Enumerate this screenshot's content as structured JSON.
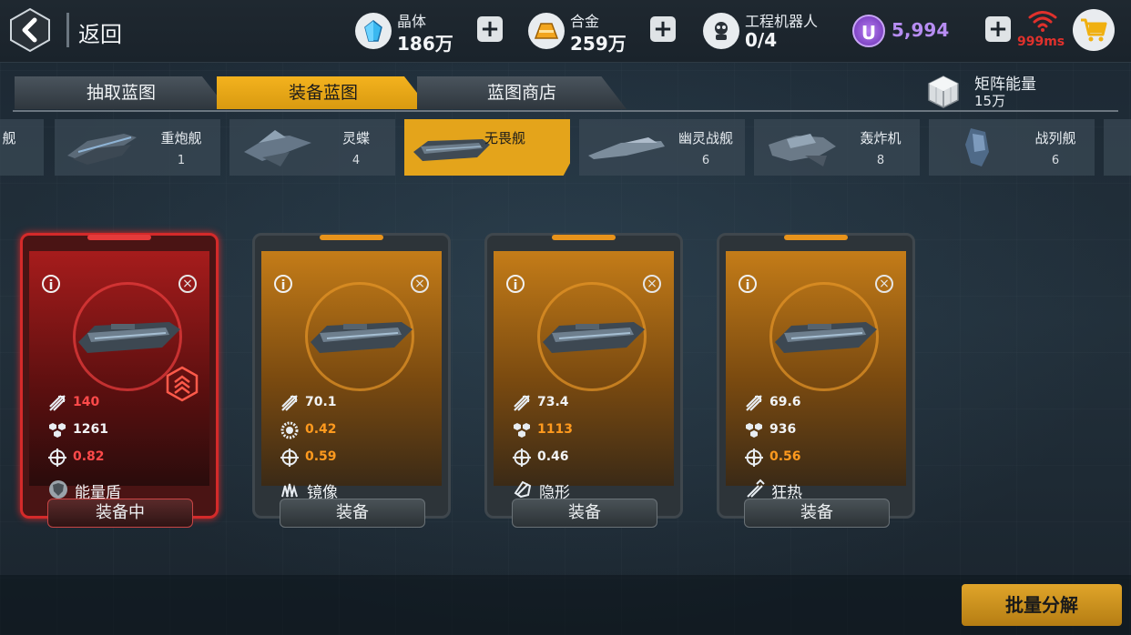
{
  "header": {
    "back_label": "返回",
    "resources": [
      {
        "name": "晶体",
        "value": "186万",
        "icon": "crystal-icon"
      },
      {
        "name": "合金",
        "value": "259万",
        "icon": "alloy-icon"
      },
      {
        "name": "工程机器人",
        "value": "0/4",
        "icon": "robot-icon"
      }
    ],
    "currency": {
      "symbol": "U",
      "value": "5,994"
    },
    "ping": "999ms"
  },
  "tabs": [
    {
      "label": "抽取蓝图",
      "active": false
    },
    {
      "label": "装备蓝图",
      "active": true
    },
    {
      "label": "蓝图商店",
      "active": false
    }
  ],
  "matrix": {
    "label": "矩阵能量",
    "value": "15万"
  },
  "ships": [
    {
      "name": "舰",
      "count": ""
    },
    {
      "name": "重炮舰",
      "count": "1"
    },
    {
      "name": "灵蝶",
      "count": "4"
    },
    {
      "name": "无畏舰",
      "count": "",
      "active": true
    },
    {
      "name": "幽灵战舰",
      "count": "6"
    },
    {
      "name": "轰炸机",
      "count": "8"
    },
    {
      "name": "战列舰",
      "count": "6"
    }
  ],
  "cards": [
    {
      "equipped": true,
      "stats": [
        {
          "icon": "attack-icon",
          "value": "140",
          "color": "red"
        },
        {
          "icon": "hull-icon",
          "value": "1261",
          "color": "white"
        },
        {
          "icon": "crosshair-icon",
          "value": "0.82",
          "color": "red"
        }
      ],
      "skill": {
        "icon": "shield-icon",
        "label": "能量盾"
      },
      "button": "装备中"
    },
    {
      "equipped": false,
      "stats": [
        {
          "icon": "attack-icon",
          "value": "70.1",
          "color": "white"
        },
        {
          "icon": "gear-icon",
          "value": "0.42",
          "color": "orange"
        },
        {
          "icon": "crosshair-icon",
          "value": "0.59",
          "color": "orange"
        }
      ],
      "skill": {
        "icon": "mirror-icon",
        "label": "镜像"
      },
      "button": "装备"
    },
    {
      "equipped": false,
      "stats": [
        {
          "icon": "attack-icon",
          "value": "73.4",
          "color": "white"
        },
        {
          "icon": "hull-icon",
          "value": "1113",
          "color": "orange"
        },
        {
          "icon": "crosshair-icon",
          "value": "0.46",
          "color": "white"
        }
      ],
      "skill": {
        "icon": "stealth-icon",
        "label": "隐形"
      },
      "button": "装备"
    },
    {
      "equipped": false,
      "stats": [
        {
          "icon": "attack-icon",
          "value": "69.6",
          "color": "white"
        },
        {
          "icon": "hull-icon",
          "value": "936",
          "color": "white"
        },
        {
          "icon": "crosshair-icon",
          "value": "0.56",
          "color": "orange"
        }
      ],
      "skill": {
        "icon": "frenzy-icon",
        "label": "狂热"
      },
      "button": "装备"
    }
  ],
  "bulk_button": "批量分解",
  "colors": {
    "accent": "#e4a41b",
    "equipped": "#d42a2a",
    "currency": "#b78df2",
    "ping": "#e0312c"
  }
}
